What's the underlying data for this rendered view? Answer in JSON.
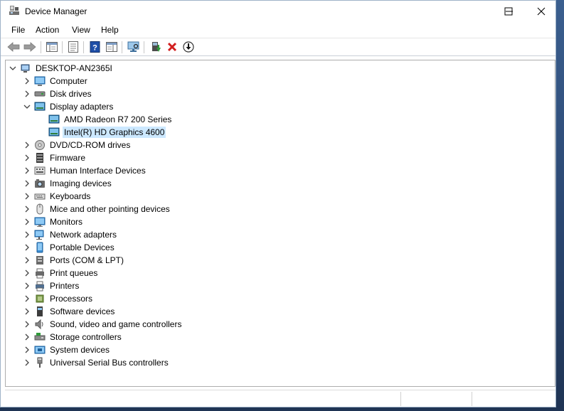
{
  "window": {
    "title": "Device Manager"
  },
  "menu": [
    {
      "label": "File"
    },
    {
      "label": "Action"
    },
    {
      "label": "View"
    },
    {
      "label": "Help"
    }
  ],
  "toolbar": [
    {
      "icon": "back-arrow-icon"
    },
    {
      "icon": "forward-arrow-icon"
    },
    {
      "icon": "show-hide-console-tree-icon"
    },
    {
      "icon": "properties-icon"
    },
    {
      "icon": "help-icon"
    },
    {
      "icon": "action-pane-icon"
    },
    {
      "icon": "scan-hardware-icon"
    },
    {
      "icon": "update-driver-icon"
    },
    {
      "icon": "uninstall-device-icon"
    },
    {
      "icon": "disable-device-icon"
    }
  ],
  "tree": {
    "root": {
      "label": "DESKTOP-AN2365I",
      "expanded": true
    },
    "nodes": [
      {
        "label": "Computer",
        "icon": "computer-icon",
        "expanded": false
      },
      {
        "label": "Disk drives",
        "icon": "disk-drive-icon",
        "expanded": false
      },
      {
        "label": "Display adapters",
        "icon": "display-adapter-icon",
        "expanded": true,
        "children": [
          {
            "label": "AMD Radeon R7 200 Series",
            "icon": "display-adapter-icon",
            "selected": false
          },
          {
            "label": "Intel(R) HD Graphics 4600",
            "icon": "display-adapter-icon",
            "selected": true
          }
        ]
      },
      {
        "label": "DVD/CD-ROM drives",
        "icon": "dvd-drive-icon",
        "expanded": false
      },
      {
        "label": "Firmware",
        "icon": "firmware-icon",
        "expanded": false
      },
      {
        "label": "Human Interface Devices",
        "icon": "hid-icon",
        "expanded": false
      },
      {
        "label": "Imaging devices",
        "icon": "camera-icon",
        "expanded": false
      },
      {
        "label": "Keyboards",
        "icon": "keyboard-icon",
        "expanded": false
      },
      {
        "label": "Mice and other pointing devices",
        "icon": "mouse-icon",
        "expanded": false
      },
      {
        "label": "Monitors",
        "icon": "monitor-icon",
        "expanded": false
      },
      {
        "label": "Network adapters",
        "icon": "network-adapter-icon",
        "expanded": false
      },
      {
        "label": "Portable Devices",
        "icon": "portable-device-icon",
        "expanded": false
      },
      {
        "label": "Ports (COM & LPT)",
        "icon": "port-icon",
        "expanded": false
      },
      {
        "label": "Print queues",
        "icon": "print-queue-icon",
        "expanded": false
      },
      {
        "label": "Printers",
        "icon": "printer-icon",
        "expanded": false
      },
      {
        "label": "Processors",
        "icon": "processor-icon",
        "expanded": false
      },
      {
        "label": "Software devices",
        "icon": "software-device-icon",
        "expanded": false
      },
      {
        "label": "Sound, video and game controllers",
        "icon": "speaker-icon",
        "expanded": false
      },
      {
        "label": "Storage controllers",
        "icon": "storage-controller-icon",
        "expanded": false
      },
      {
        "label": "System devices",
        "icon": "system-device-icon",
        "expanded": false
      },
      {
        "label": "Universal Serial Bus controllers",
        "icon": "usb-icon",
        "expanded": false
      }
    ]
  },
  "colors": {
    "selection": "#cce8ff",
    "accent_blue": "#1e7ad4",
    "delete_red": "#d21f1f",
    "driver_green": "#2f9a3a"
  }
}
